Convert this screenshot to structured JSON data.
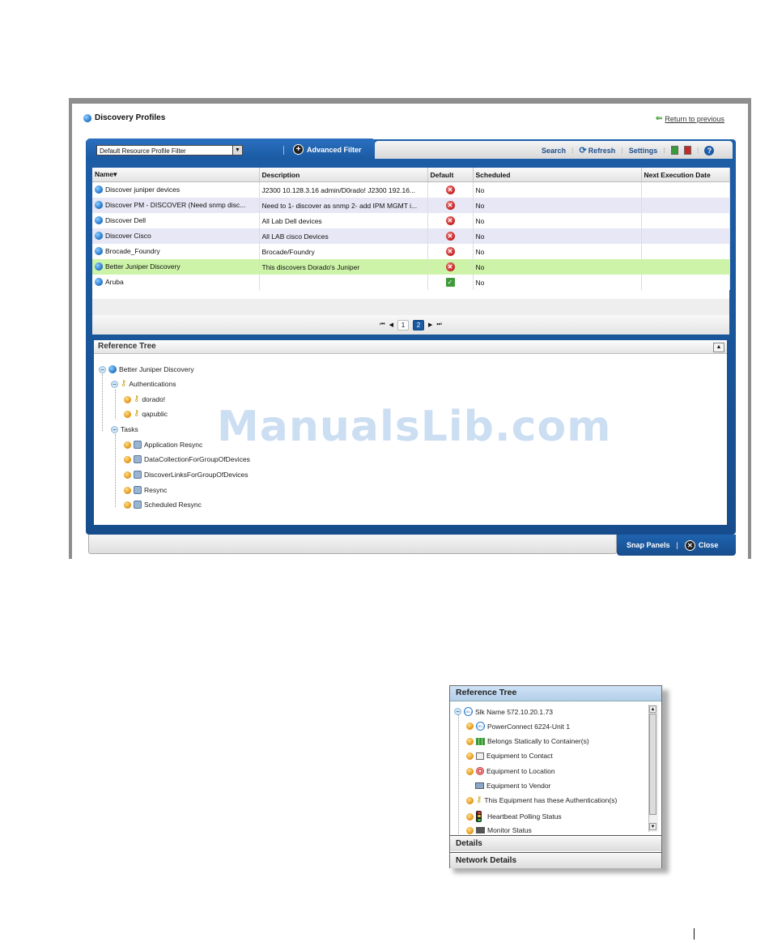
{
  "window": {
    "title": "Discovery Profiles",
    "return_link": "Return to previous"
  },
  "filter": {
    "selected": "Default Resource Profile Filter",
    "advanced_label": "Advanced Filter"
  },
  "toolbar": {
    "search": "Search",
    "refresh": "Refresh",
    "settings": "Settings"
  },
  "table": {
    "columns": [
      "Name",
      "Description",
      "Default",
      "Scheduled",
      "Next Execution Date"
    ],
    "rows": [
      {
        "name": "Discover juniper devices",
        "description": "J2300 10.128.3.16 admin/D0rado! J2300 192.16...",
        "default": "no",
        "scheduled": "No",
        "next": ""
      },
      {
        "name": "Discover PM - DISCOVER (Need snmp disc...",
        "description": "Need to 1- discover as snmp 2- add IPM MGMT i...",
        "default": "no",
        "scheduled": "No",
        "next": ""
      },
      {
        "name": "Discover Dell",
        "description": "All Lab Dell devices",
        "default": "no",
        "scheduled": "No",
        "next": ""
      },
      {
        "name": "Discover Cisco",
        "description": "All LAB cisco Devices",
        "default": "no",
        "scheduled": "No",
        "next": ""
      },
      {
        "name": "Brocade_Foundry",
        "description": "Brocade/Foundry",
        "default": "no",
        "scheduled": "No",
        "next": ""
      },
      {
        "name": "Better Juniper Discovery",
        "description": "This discovers Dorado's Juniper",
        "default": "no",
        "scheduled": "No",
        "next": ""
      },
      {
        "name": "Aruba",
        "description": "",
        "default": "yes",
        "scheduled": "No",
        "next": ""
      }
    ]
  },
  "pager": {
    "pages": [
      "1",
      "2"
    ],
    "current": "2"
  },
  "reference_tree": {
    "title": "Reference Tree",
    "root": "Better Juniper Discovery",
    "authentications_label": "Authentications",
    "authentications": [
      "dorado!",
      "qapublic"
    ],
    "tasks_label": "Tasks",
    "tasks": [
      "Application Resync",
      "DataCollectionForGroupOfDevices",
      "DiscoverLinksForGroupOfDevices",
      "Resync",
      "Scheduled Resync"
    ]
  },
  "bottom": {
    "snap_panels": "Snap Panels",
    "close": "Close"
  },
  "watermark": "ManualsLib.com",
  "small_panel": {
    "title": "Reference Tree",
    "items": [
      "Slk Name 572.10.20.1.73",
      "PowerConnect 6224-Unit 1",
      "Belongs Statically to Container(s)",
      "Equipment to Contact",
      "Equipment to Location",
      "Equipment to Vendor",
      "This Equipment has these Authentication(s)",
      "Heartbeat Polling Status",
      "Monitor Status"
    ],
    "details_label": "Details",
    "network_details_label": "Network Details"
  },
  "colors": {
    "panel_blue": "#1c5ea8",
    "selected_row": "#cdf3a8",
    "alt_row": "#e7e7f5"
  }
}
